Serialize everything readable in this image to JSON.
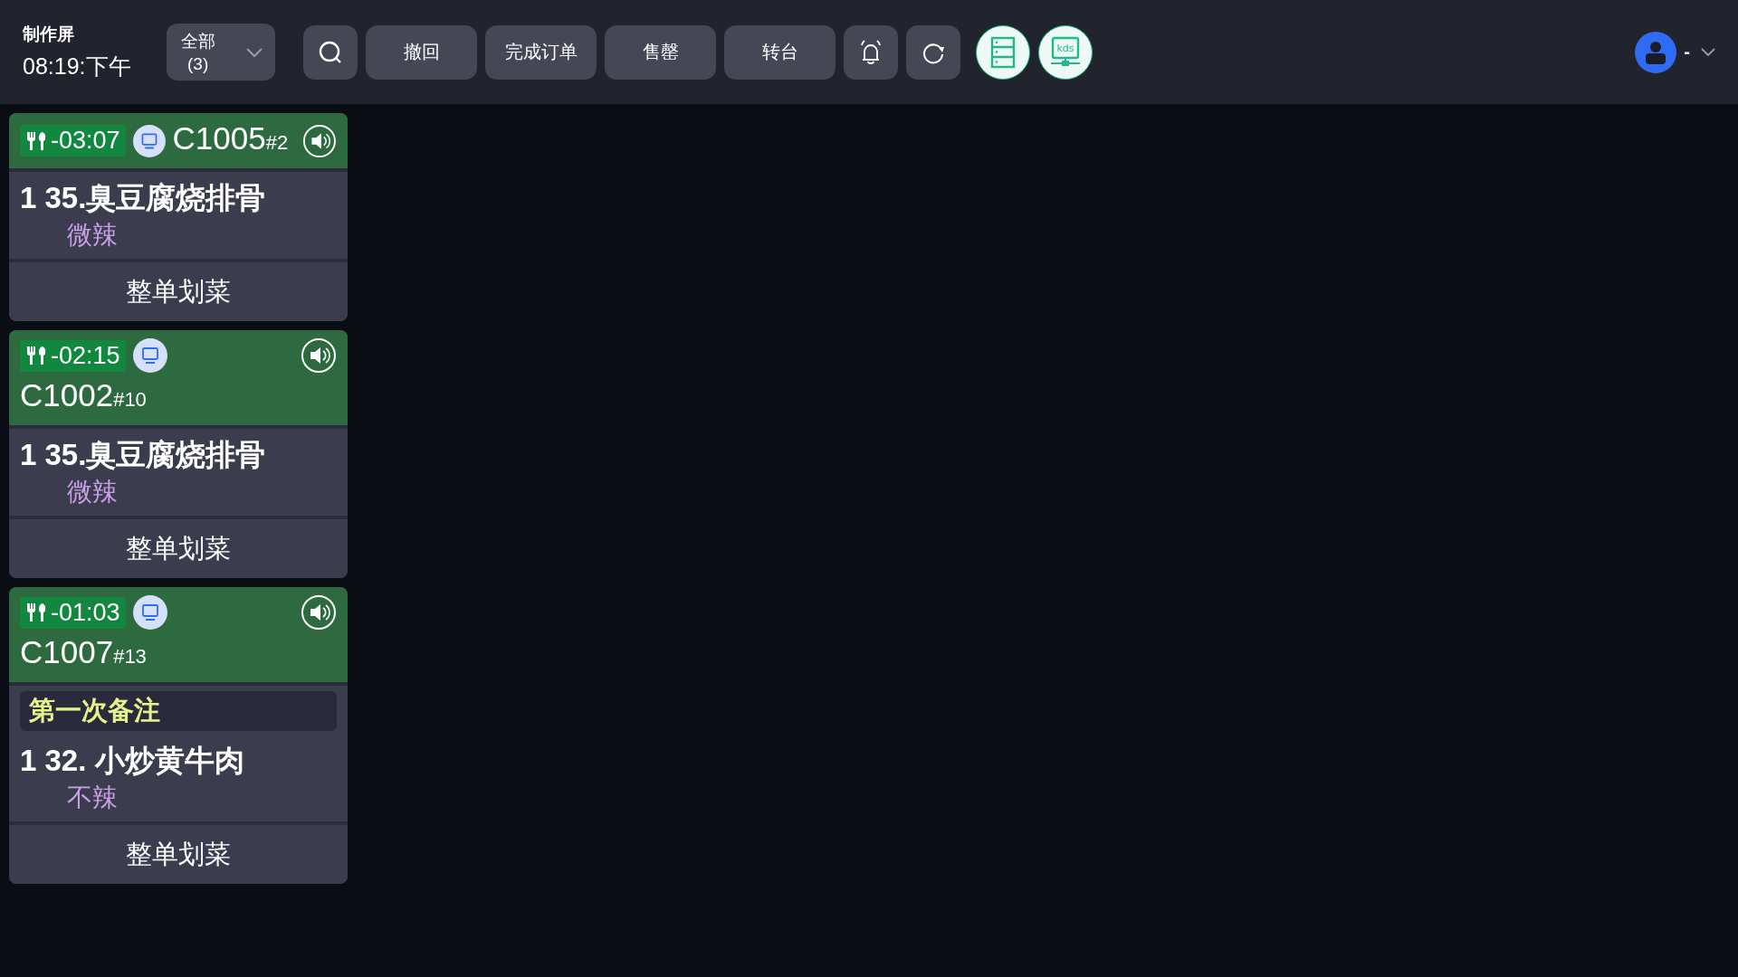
{
  "header": {
    "title": "制作屏",
    "time": "08:19:下午",
    "filter": {
      "label": "全部",
      "count": "(3)"
    },
    "buttons": [
      "撤回",
      "完成订单",
      "售罄",
      "转台"
    ],
    "kds_label": "kds",
    "user": {
      "name": "-"
    }
  },
  "orders": [
    {
      "kind": "single",
      "timer": "-03:07",
      "table": "C1005",
      "seq": "#2",
      "items": [
        {
          "qty": "1",
          "name": "35.臭豆腐烧排骨",
          "modifier": "微辣"
        }
      ],
      "action": "整单划菜"
    },
    {
      "kind": "double",
      "timer": "-02:15",
      "table": "C1002",
      "seq": "#10",
      "items": [
        {
          "qty": "1",
          "name": "35.臭豆腐烧排骨",
          "modifier": "微辣"
        }
      ],
      "action": "整单划菜"
    },
    {
      "kind": "double",
      "timer": "-01:03",
      "table": "C1007",
      "seq": "#13",
      "note": "第一次备注",
      "items": [
        {
          "qty": "1",
          "name": "32. 小炒黄牛肉",
          "modifier": "不辣"
        }
      ],
      "action": "整单划菜"
    }
  ]
}
